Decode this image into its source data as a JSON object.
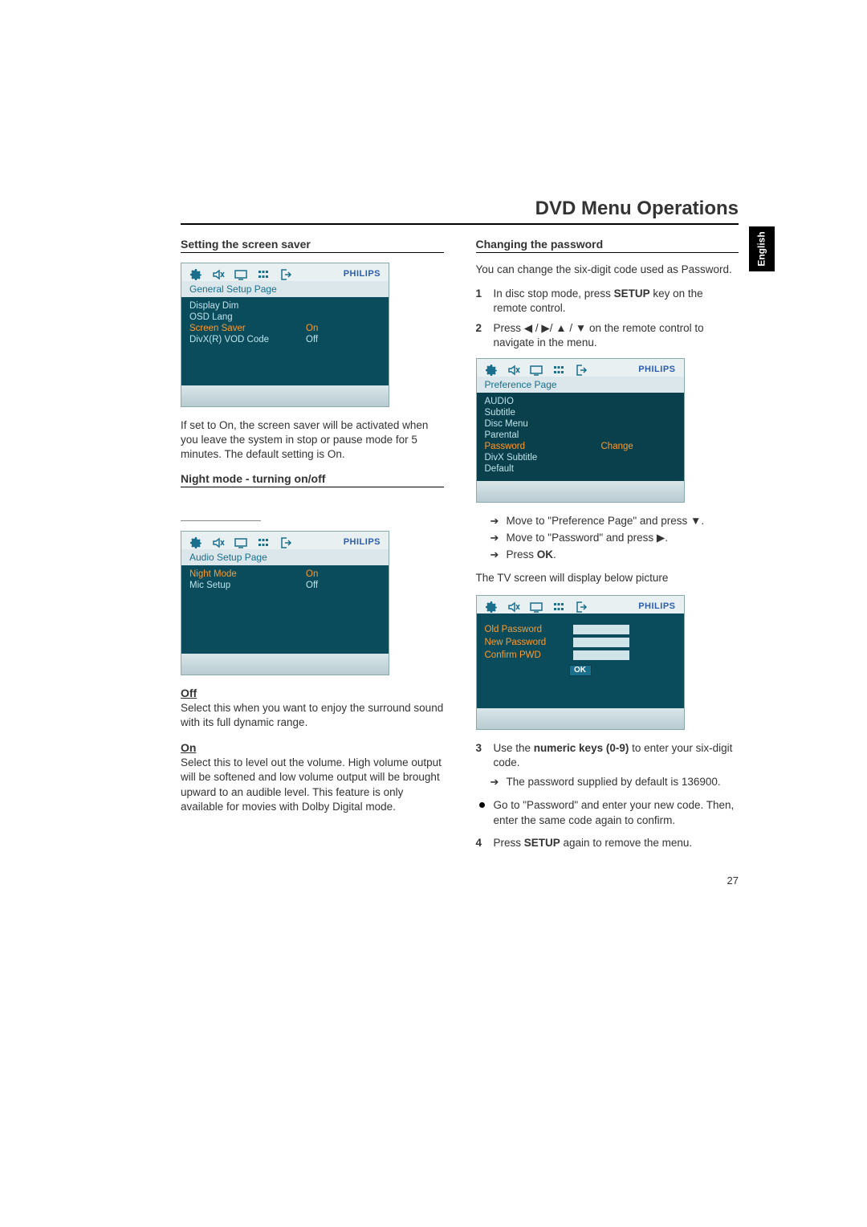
{
  "page": {
    "title": "DVD Menu Operations",
    "language_tab": "English",
    "page_number": "27"
  },
  "icons": {
    "brand": "PHILIPS"
  },
  "left": {
    "section1": {
      "heading": "Setting the screen saver",
      "osd": {
        "page_name": "General Setup Page",
        "rows": [
          {
            "label": "Display Dim",
            "value": ""
          },
          {
            "label": "OSD Lang",
            "value": ""
          },
          {
            "label": "Screen Saver",
            "value": "On",
            "selected": true
          },
          {
            "label": "DivX(R) VOD Code",
            "value": "Off"
          }
        ]
      },
      "paragraph": "If set to On, the screen saver will be activated when you leave the system in stop or pause mode for 5 minutes. The default setting is On."
    },
    "section2": {
      "heading": "Night mode - turning on/off",
      "osd": {
        "page_name": "Audio Setup Page",
        "rows": [
          {
            "label": "Night Mode",
            "value": "On",
            "selected": true
          },
          {
            "label": "Mic Setup",
            "value": "Off"
          }
        ]
      },
      "off": {
        "label": "Off",
        "text": "Select this when you want to enjoy the surround sound with its full dynamic range."
      },
      "on": {
        "label": "On",
        "text": "Select this to level out the volume. High volume output will be softened and low volume output will be brought upward to an audible level. This feature is only available for movies with Dolby Digital mode."
      }
    }
  },
  "right": {
    "section1": {
      "heading": "Changing the password",
      "intro": "You can change the six-digit code used as Password.",
      "steps_a": [
        {
          "num": "1",
          "pre": "In disc stop mode, press ",
          "bold": "SETUP",
          "post": " key on the remote control."
        },
        {
          "num": "2",
          "pre": "Press ",
          "arrows": "◀ / ▶/ ▲ / ▼",
          "post": " on the remote control to navigate in the menu."
        }
      ],
      "osd_pref": {
        "page_name": "Preference Page",
        "rows": [
          {
            "label": "AUDIO",
            "value": ""
          },
          {
            "label": "Subtitle",
            "value": ""
          },
          {
            "label": "Disc Menu",
            "value": ""
          },
          {
            "label": "Parental",
            "value": ""
          },
          {
            "label": "Password",
            "value": "Change",
            "selected": true
          },
          {
            "label": "DivX Subtitle",
            "value": ""
          },
          {
            "label": "Default",
            "value": ""
          }
        ]
      },
      "arrows_a": [
        "Move to \"Preference Page\"  and press ▼.",
        "Move to \"Password\" and press ▶.",
        "Press OK."
      ],
      "mid_text": "The  TV screen will display below picture",
      "osd_pw": {
        "rows": [
          {
            "plabel": "Old Password"
          },
          {
            "plabel": "New Password"
          },
          {
            "plabel": "Confirm PWD"
          }
        ],
        "ok": "OK"
      },
      "steps_b": [
        {
          "num": "3",
          "pre": "Use the ",
          "bold": "numeric keys (0-9)",
          "post": " to enter your  six-digit code."
        }
      ],
      "arrows_b": [
        "The password supplied by default is 136900."
      ],
      "dots": [
        "Go to \"Password\" and enter your new code. Then, enter the same code again to confirm."
      ],
      "steps_c": [
        {
          "num": "4",
          "pre": "Press ",
          "bold": "SETUP",
          "post": " again to remove the menu."
        }
      ]
    }
  }
}
